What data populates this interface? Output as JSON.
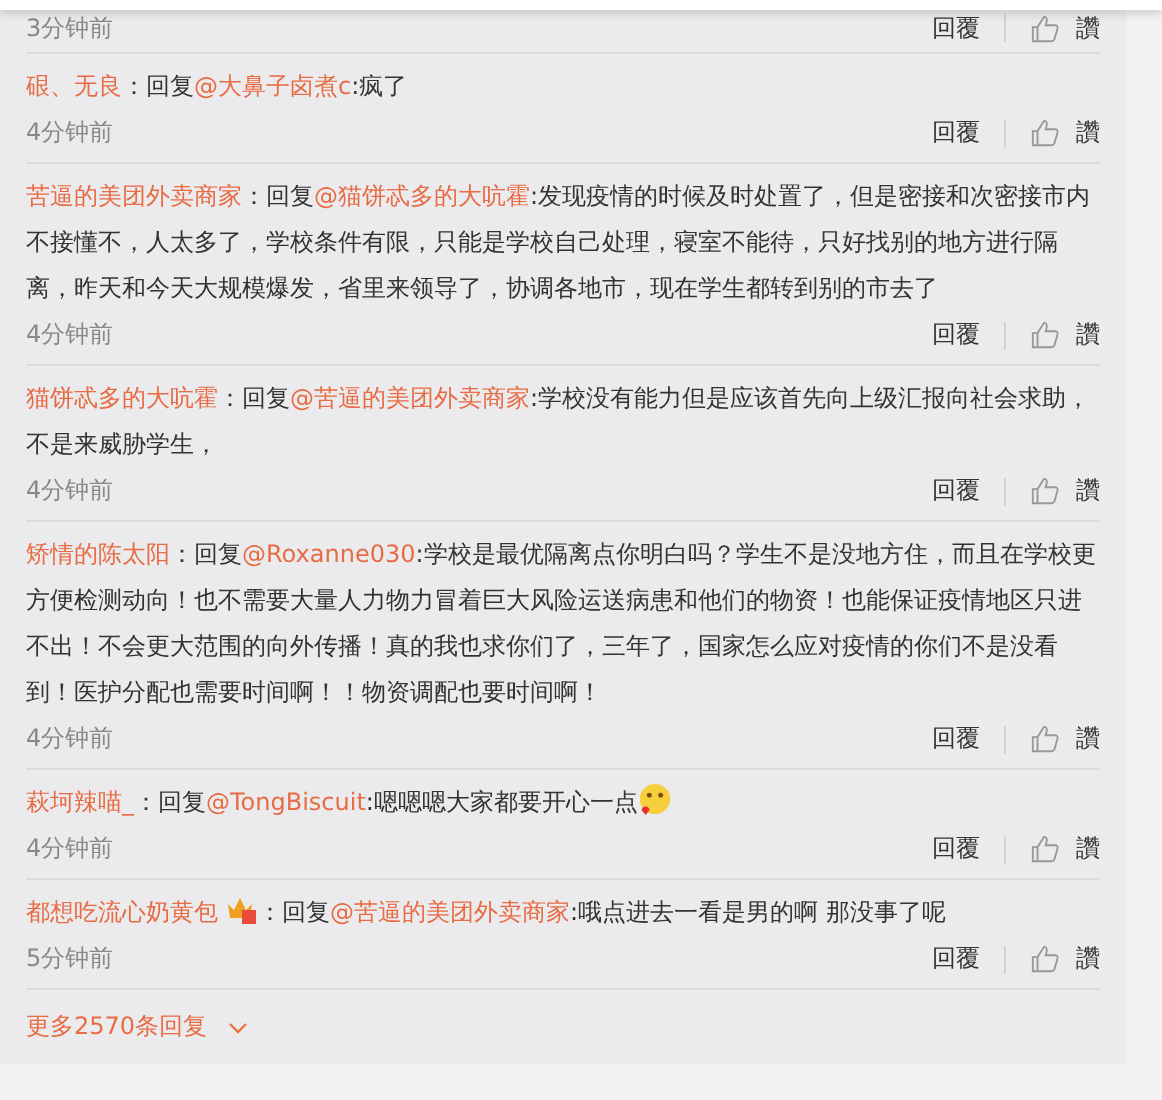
{
  "comments": [
    {
      "kind": "tail",
      "time": "3分钟前",
      "reply_label": "回覆",
      "like_label": "讚"
    },
    {
      "kind": "full",
      "user": "硍、无良",
      "reply_prefix": "：回复",
      "reply_to": "@大鼻子卤煮c",
      "text": ":疯了",
      "time": "4分钟前",
      "reply_label": "回覆",
      "like_label": "讚"
    },
    {
      "kind": "full",
      "user": "苦逼的美团外卖商家",
      "reply_prefix": "：回复",
      "reply_to": "@猫饼忒多的大吭霍",
      "text": ":发现疫情的时候及时处置了，但是密接和次密接市内不接懂不，人太多了，学校条件有限，只能是学校自己处理，寝室不能待，只好找别的地方进行隔离，昨天和今天大规模爆发，省里来领导了，协调各地市，现在学生都转到别的市去了",
      "time": "4分钟前",
      "reply_label": "回覆",
      "like_label": "讚"
    },
    {
      "kind": "full",
      "user": "猫饼忒多的大吭霍",
      "reply_prefix": "：回复",
      "reply_to": "@苦逼的美团外卖商家",
      "text": ":学校没有能力但是应该首先向上级汇报向社会求助，不是来威胁学生，",
      "time": "4分钟前",
      "reply_label": "回覆",
      "like_label": "讚"
    },
    {
      "kind": "full",
      "user": "矫情的陈太阳",
      "reply_prefix": "：回复",
      "reply_to": "@Roxanne030",
      "text": ":学校是最优隔离点你明白吗？学生不是没地方住，而且在学校更方便检测动向！也不需要大量人力物力冒着巨大风险运送病患和他们的物资！也能保证疫情地区只进不出！不会更大范围的向外传播！真的我也求你们了，三年了，国家怎么应对疫情的你们不是没看到！医护分配也需要时间啊！！物资调配也要时间啊！",
      "time": "4分钟前",
      "reply_label": "回覆",
      "like_label": "讚"
    },
    {
      "kind": "full",
      "user": "萩坷辣喵_",
      "reply_prefix": "：回复",
      "reply_to": "@TongBiscuit",
      "text": ":嗯嗯嗯大家都要开心一点",
      "emoji": true,
      "time": "4分钟前",
      "reply_label": "回覆",
      "like_label": "讚"
    },
    {
      "kind": "full",
      "user": "都想吃流心奶黄包",
      "badge": true,
      "reply_prefix": "：回复",
      "reply_to": "@苦逼的美团外卖商家",
      "text": ":哦点进去一看是男的啊 那没事了呢",
      "time": "5分钟前",
      "reply_label": "回覆",
      "like_label": "讚"
    }
  ],
  "more": {
    "label": "更多2570条回复"
  }
}
